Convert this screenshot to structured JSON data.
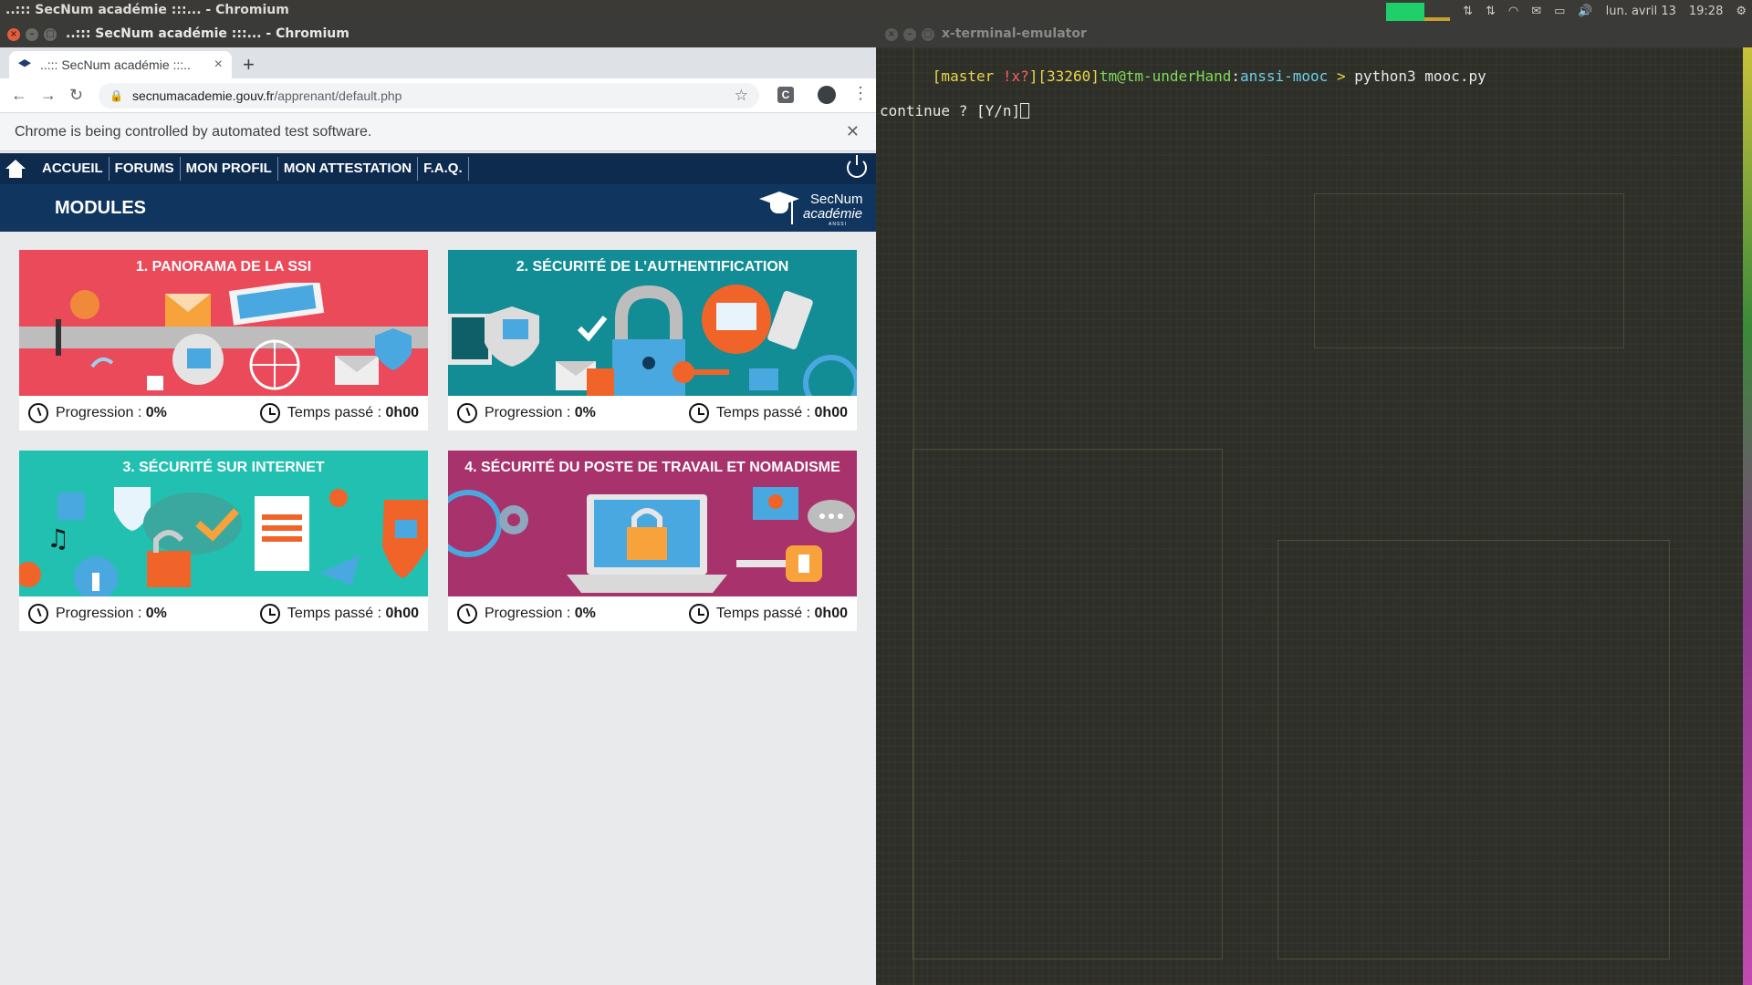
{
  "panel": {
    "title": "..::: SecNum académie :::... - Chromium",
    "date": "lun. avril 13",
    "time": "19:28"
  },
  "browser": {
    "window_title": "..::: SecNum académie :::... - Chromium",
    "tab_label": "..::: SecNum académie :::..",
    "url_host": "secnumacademie.gouv.fr",
    "url_path": "/apprenant/default.php",
    "infobar_text": "Chrome is being controlled by automated test software.",
    "ext_label": "C"
  },
  "site": {
    "nav": [
      "ACCUEIL",
      "FORUMS",
      "MON PROFIL",
      "MON ATTESTATION",
      "F.A.Q."
    ],
    "section_title": "MODULES",
    "logo": {
      "line1": "SecNum",
      "line2": "académie",
      "line3": "ANSSI"
    },
    "progress_label": "Progression : ",
    "time_label": "Temps passé : ",
    "modules": [
      {
        "title": "1. PANORAMA DE LA SSI",
        "progress": "0%",
        "time": "0h00",
        "color": "#ea4a5a"
      },
      {
        "title": "2. SÉCURITÉ DE L'AUTHENTIFICATION",
        "progress": "0%",
        "time": "0h00",
        "color": "#138d95"
      },
      {
        "title": "3. SÉCURITÉ SUR INTERNET",
        "progress": "0%",
        "time": "0h00",
        "color": "#22c0b0"
      },
      {
        "title": "4. SÉCURITÉ DU POSTE DE TRAVAIL ET NOMADISME",
        "progress": "0%",
        "time": "0h00",
        "color": "#a8326c"
      }
    ]
  },
  "terminal": {
    "title": "x-terminal-emulator",
    "prompt_branch": "[master ",
    "prompt_flags": "!x?",
    "prompt_close": "]",
    "prompt_pid": "[33260]",
    "prompt_user": "tm@tm-underHand",
    "prompt_colon": ":",
    "prompt_path": "anssi-mooc",
    "prompt_arrow": " > ",
    "command": "python3 mooc.py",
    "line2": "continue ? [Y/n]"
  }
}
